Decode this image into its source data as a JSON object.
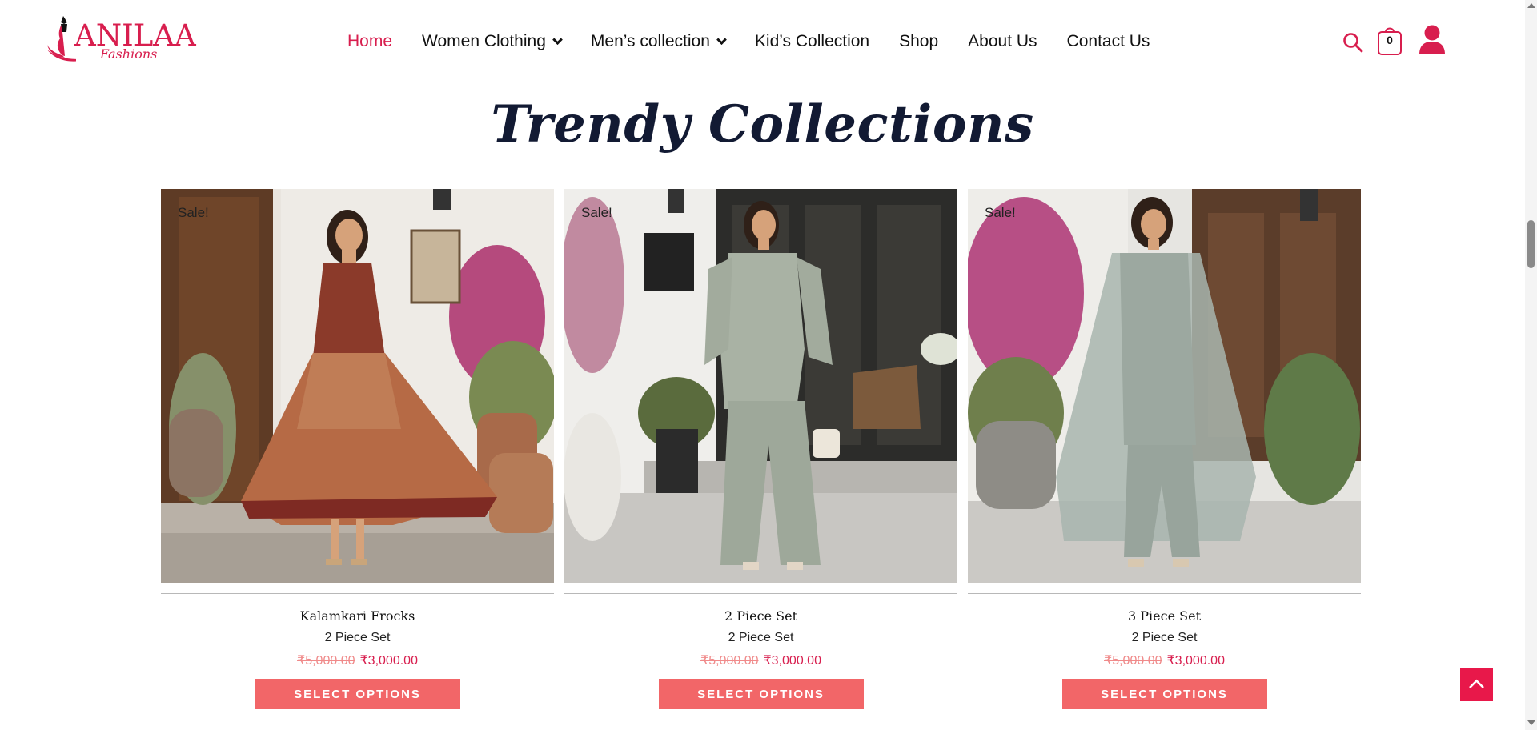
{
  "brand": {
    "name": "ANILAA",
    "tagline": "Fashions",
    "color": "#d81e4e"
  },
  "nav": {
    "items": [
      {
        "label": "Home",
        "active": true
      },
      {
        "label": "Women Clothing",
        "has_dropdown": true
      },
      {
        "label": "Men’s collection",
        "has_dropdown": true
      },
      {
        "label": "Kid’s Collection"
      },
      {
        "label": "Shop"
      },
      {
        "label": "About Us"
      },
      {
        "label": "Contact Us"
      }
    ]
  },
  "header": {
    "cart_count": "0",
    "icons": [
      "search-icon",
      "cart-icon",
      "user-icon"
    ]
  },
  "section": {
    "title": "Trendy Collections"
  },
  "products": [
    {
      "badge": "Sale!",
      "title": "Kalamkari Frocks",
      "category": "2 Piece Set",
      "old_price": "₹5,000.00",
      "price": "₹3,000.00",
      "button": "SELECT OPTIONS"
    },
    {
      "badge": "Sale!",
      "title": "2 Piece Set",
      "category": "2 Piece Set",
      "old_price": "₹5,000.00",
      "price": "₹3,000.00",
      "button": "SELECT OPTIONS"
    },
    {
      "badge": "Sale!",
      "title": "3 Piece Set",
      "category": "2 Piece Set",
      "old_price": "₹5,000.00",
      "price": "₹3,000.00",
      "button": "SELECT OPTIONS"
    }
  ],
  "colors": {
    "accent": "#d81e4e",
    "button": "#f26668",
    "heading": "#121a33"
  }
}
